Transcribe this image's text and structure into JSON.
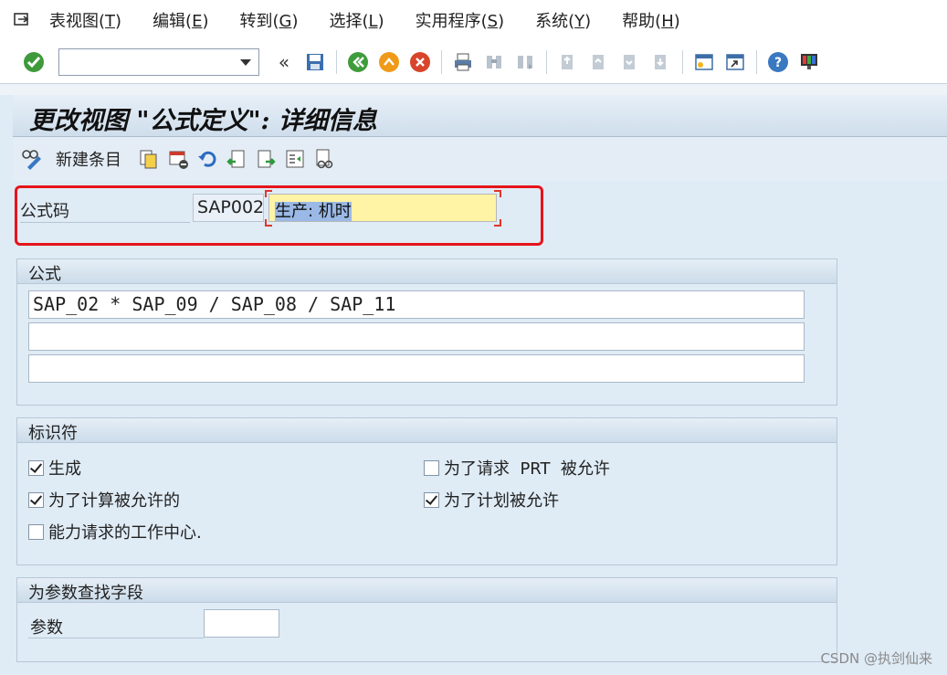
{
  "menubar": {
    "items": [
      {
        "label": "表视图(",
        "key": "T",
        "suffix": ")"
      },
      {
        "label": "编辑(",
        "key": "E",
        "suffix": ")"
      },
      {
        "label": "转到(",
        "key": "G",
        "suffix": ")"
      },
      {
        "label": "选择(",
        "key": "L",
        "suffix": ")"
      },
      {
        "label": "实用程序(",
        "key": "S",
        "suffix": ")"
      },
      {
        "label": "系统(",
        "key": "Y",
        "suffix": ")"
      },
      {
        "label": "帮助(",
        "key": "H",
        "suffix": ")"
      }
    ]
  },
  "toolbar": {
    "command_value": "",
    "icons": [
      "enter-icon",
      "save-icon",
      "back-icon",
      "exit-icon",
      "cancel-icon",
      "print-icon",
      "find-icon",
      "find-next-icon",
      "first-page-icon",
      "prev-page-icon",
      "next-page-icon",
      "last-page-icon",
      "create-session-icon",
      "shortcut-icon",
      "help-icon",
      "customize-layout-icon"
    ]
  },
  "page": {
    "title": "更改视图 \"公式定义\": 详细信息"
  },
  "app_toolbar": {
    "new_entries_label": "新建条目"
  },
  "key": {
    "label": "公式码",
    "value": "SAP002",
    "description": "生产: 机时"
  },
  "formula_group": {
    "title": "公式",
    "lines": [
      "SAP_02 * SAP_09 / SAP_08 / SAP_11",
      "",
      ""
    ]
  },
  "indicators_group": {
    "title": "标识符",
    "items": [
      {
        "label": "生成",
        "checked": true
      },
      {
        "label": "为了请求  PRT  被允许",
        "checked": false
      },
      {
        "label": "为了计算被允许的",
        "checked": true
      },
      {
        "label": "为了计划被允许",
        "checked": true
      },
      {
        "label": "能力请求的工作中心.",
        "checked": false
      }
    ]
  },
  "param_group": {
    "title": "为参数查找字段",
    "param_label": "参数",
    "param_value": ""
  },
  "watermark": "CSDN @执剑仙来",
  "colors": {
    "highlight_border": "#e6141a",
    "description_bg": "#fff3a6",
    "background": "#dfebf5"
  }
}
